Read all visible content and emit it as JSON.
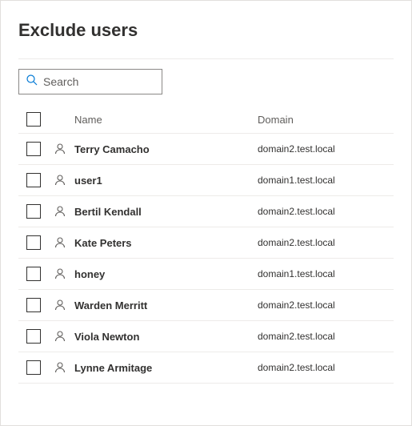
{
  "title": "Exclude users",
  "search": {
    "placeholder": "Search"
  },
  "columns": {
    "name": "Name",
    "domain": "Domain"
  },
  "rows": [
    {
      "name": "Terry Camacho",
      "domain": "domain2.test.local"
    },
    {
      "name": "user1",
      "domain": "domain1.test.local"
    },
    {
      "name": "Bertil Kendall",
      "domain": "domain2.test.local"
    },
    {
      "name": "Kate Peters",
      "domain": "domain2.test.local"
    },
    {
      "name": "honey",
      "domain": "domain1.test.local"
    },
    {
      "name": "Warden Merritt",
      "domain": "domain2.test.local"
    },
    {
      "name": "Viola Newton",
      "domain": "domain2.test.local"
    },
    {
      "name": "Lynne Armitage",
      "domain": "domain2.test.local"
    }
  ]
}
